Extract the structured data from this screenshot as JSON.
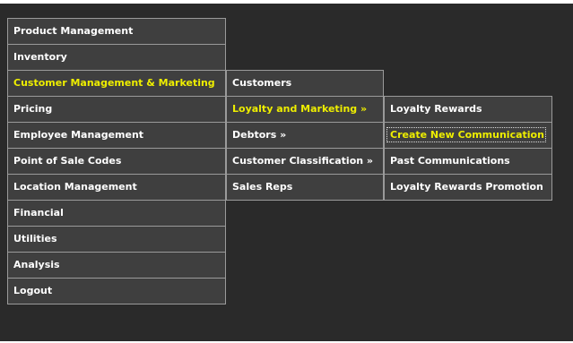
{
  "menu": {
    "level1": [
      {
        "label": "Product Management"
      },
      {
        "label": "Inventory"
      },
      {
        "label": "Customer Management & Marketing"
      },
      {
        "label": "Pricing"
      },
      {
        "label": "Employee Management"
      },
      {
        "label": "Point of Sale Codes"
      },
      {
        "label": "Location Management"
      },
      {
        "label": "Financial"
      },
      {
        "label": "Utilities"
      },
      {
        "label": "Analysis"
      },
      {
        "label": "Logout"
      }
    ],
    "level2": [
      {
        "label": "Customers"
      },
      {
        "label": "Loyalty and Marketing »"
      },
      {
        "label": "Debtors »"
      },
      {
        "label": "Customer Classification »"
      },
      {
        "label": "Sales Reps"
      }
    ],
    "level3": [
      {
        "label": "Loyalty Rewards"
      },
      {
        "label": "Create New Communication"
      },
      {
        "label": "Past Communications"
      },
      {
        "label": "Loyalty Rewards Promotion"
      }
    ]
  },
  "colors": {
    "background": "#2a2a2a",
    "item_background": "#3f3f3f",
    "item_border": "#9a9a9a",
    "text": "#ffffff",
    "active_text": "#eeee00"
  }
}
